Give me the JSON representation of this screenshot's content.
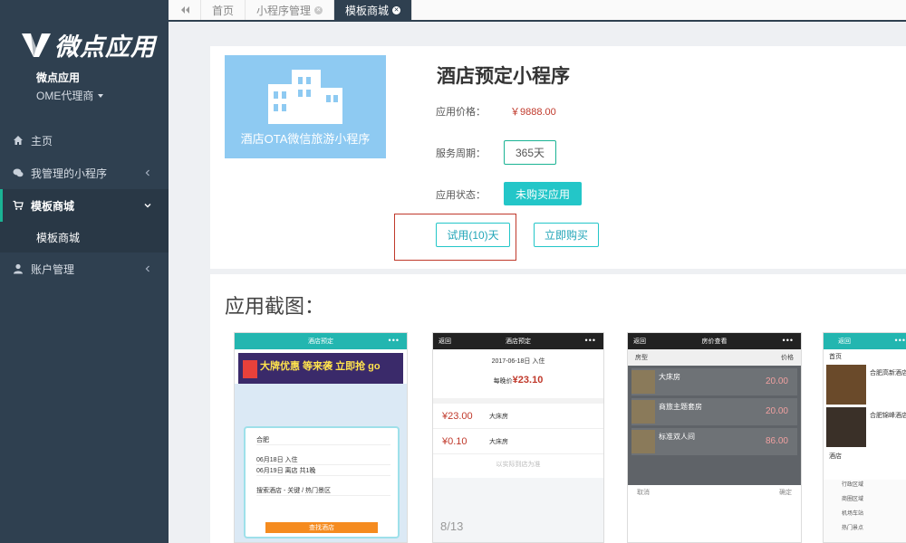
{
  "brand": {
    "name": "微点应用",
    "subtitle": "微点应用",
    "agent": "OME代理商"
  },
  "sidebar": {
    "items": [
      {
        "label": "主页"
      },
      {
        "label": "我管理的小程序"
      },
      {
        "label": "模板商城"
      },
      {
        "label": "账户管理"
      }
    ],
    "sub_items": [
      {
        "label": "模板商城"
      }
    ]
  },
  "tabs": [
    {
      "label": "首页"
    },
    {
      "label": "小程序管理"
    },
    {
      "label": "模板商城"
    }
  ],
  "product": {
    "cover_text": "酒店OTA微信旅游小程序",
    "title": "酒店预定小程序",
    "price_label": "应用价格：",
    "price": "￥9888.00",
    "period_label": "服务周期：",
    "period": "365天",
    "status_label": "应用状态：",
    "status": "未购买应用",
    "trial_button": "试用(10)天",
    "buy_button": "立即购买"
  },
  "screenshots": {
    "title": "应用截图：",
    "pager": "8/13",
    "phone1": {
      "bar": "酒店预定",
      "dots": "•••",
      "banner": "大牌优惠 等来袭 立即抢 go",
      "city": "合肥",
      "checkin": "06月18日 入住",
      "checkout": "06月19日 离店 共1晚",
      "keyword": "搜索酒店 - 关键 / 热门景区",
      "search": "查找酒店"
    },
    "phone2": {
      "back": "返回",
      "bar": "酒店预定",
      "dots": "•••",
      "date": "2017-06-18日 入住",
      "lowest_prefix": "每晚价",
      "lowest": "¥23.10",
      "rows": [
        {
          "price": "¥23.00",
          "name": "大床房"
        },
        {
          "price": "¥0.10",
          "name": "大床房"
        }
      ],
      "note": "以实际到店为准"
    },
    "phone3": {
      "back": "返回",
      "bar": "房价查看",
      "dots": "•••",
      "tab_left": "房型",
      "tab_right": "价格",
      "rooms": [
        {
          "name": "大床房",
          "price": "20.00"
        },
        {
          "name": "商旅主题套房",
          "price": "20.00"
        },
        {
          "name": "标准双人间",
          "price": "86.00"
        }
      ],
      "bottom_left": "取消",
      "bottom_right": "确定"
    },
    "phone4": {
      "back": "返回",
      "dots": "•••",
      "tab": "首页",
      "hotels": [
        {
          "name": "合肥高新酒店"
        },
        {
          "name": "合肥锦峰酒店"
        }
      ],
      "section": "酒店",
      "cats": [
        "行政区域",
        "商圈区域",
        "机场车站",
        "热门景点"
      ]
    }
  },
  "colors": {
    "sidebar": "#2f4050",
    "accent": "#1ab394",
    "teal": "#23c6c8",
    "price": "#c0392b"
  }
}
